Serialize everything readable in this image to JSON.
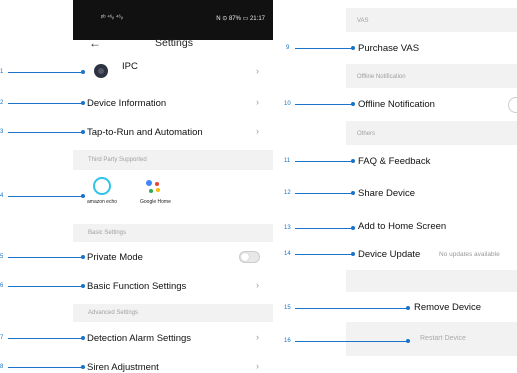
{
  "status_bar": {
    "signal": "ᵖᵇ ⁴⁶ᵢₗ ⁴⁶ᵢₗ",
    "battery": "N ⊙ 87% ▭ 21:17"
  },
  "header": {
    "back_icon": "arrow-left-icon",
    "title": "Settings"
  },
  "device": {
    "name": "IPC"
  },
  "left_rows": {
    "device_info": "Device Information",
    "tap_to_run": "Tap-to-Run and Automation",
    "private_mode": "Private Mode",
    "basic_function": "Basic Function Settings",
    "detection_alarm": "Detection Alarm Settings",
    "siren": "Siren Adjustment"
  },
  "sections_left": {
    "third_party": "Third Party Supported",
    "basic_settings": "Basic Settings",
    "advanced_settings": "Advanced Settings"
  },
  "third_party": {
    "amazon_label": "amazon echo",
    "google_label": "Google Home"
  },
  "sections_right": {
    "vas": "VAS",
    "offline": "Offline Notification",
    "others": "Others"
  },
  "right_rows": {
    "purchase_vas": "Purchase VAS",
    "offline_notification": "Offline Notification",
    "faq": "FAQ & Feedback",
    "share": "Share Device",
    "add_home": "Add to Home Screen",
    "device_update": "Device Update",
    "device_update_status": "No updates available",
    "remove": "Remove Device",
    "restart": "Restart Device"
  },
  "callouts": [
    "1",
    "2",
    "3",
    "4",
    "5",
    "6",
    "7",
    "8",
    "9",
    "10",
    "11",
    "12",
    "13",
    "14",
    "15",
    "16"
  ],
  "colors": {
    "callout": "#1a73c8",
    "section_bg": "#f2f2f2"
  }
}
